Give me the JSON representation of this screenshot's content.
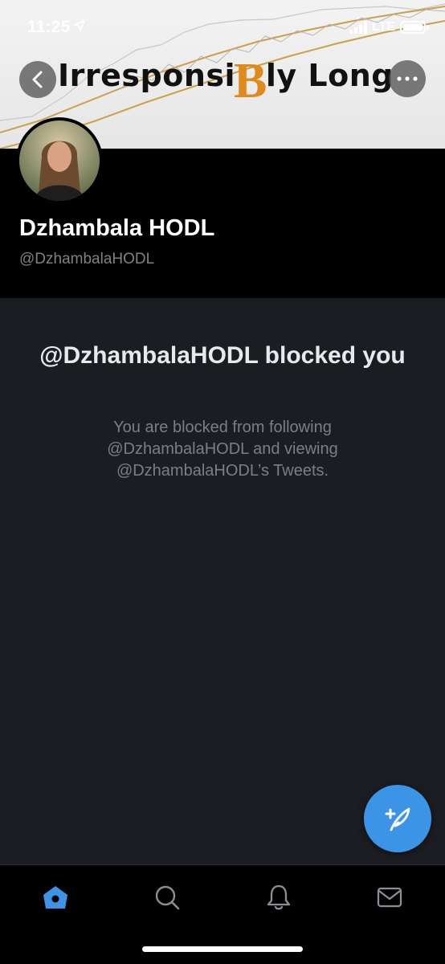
{
  "status_bar": {
    "time": "11:25",
    "carrier": "LTE"
  },
  "banner": {
    "title_left": "Irresponsi",
    "title_symbol": "B",
    "title_right": "ly Long"
  },
  "profile": {
    "name": "Dzhambala HODL",
    "handle": "@DzhambalaHODL"
  },
  "blocked": {
    "title": "@DzhambalaHODL blocked you",
    "description": "You are blocked from following @DzhambalaHODL and viewing @DzhambalaHODL’s Tweets."
  },
  "tabs": [
    {
      "icon": "home-icon",
      "active": true
    },
    {
      "icon": "search-icon",
      "active": false
    },
    {
      "icon": "notifications-icon",
      "active": false
    },
    {
      "icon": "messages-icon",
      "active": false
    }
  ],
  "colors": {
    "accent": "#3b94e5",
    "background": "#1b1d22",
    "header": "#000000",
    "bitcoin": "#e08a1e"
  }
}
